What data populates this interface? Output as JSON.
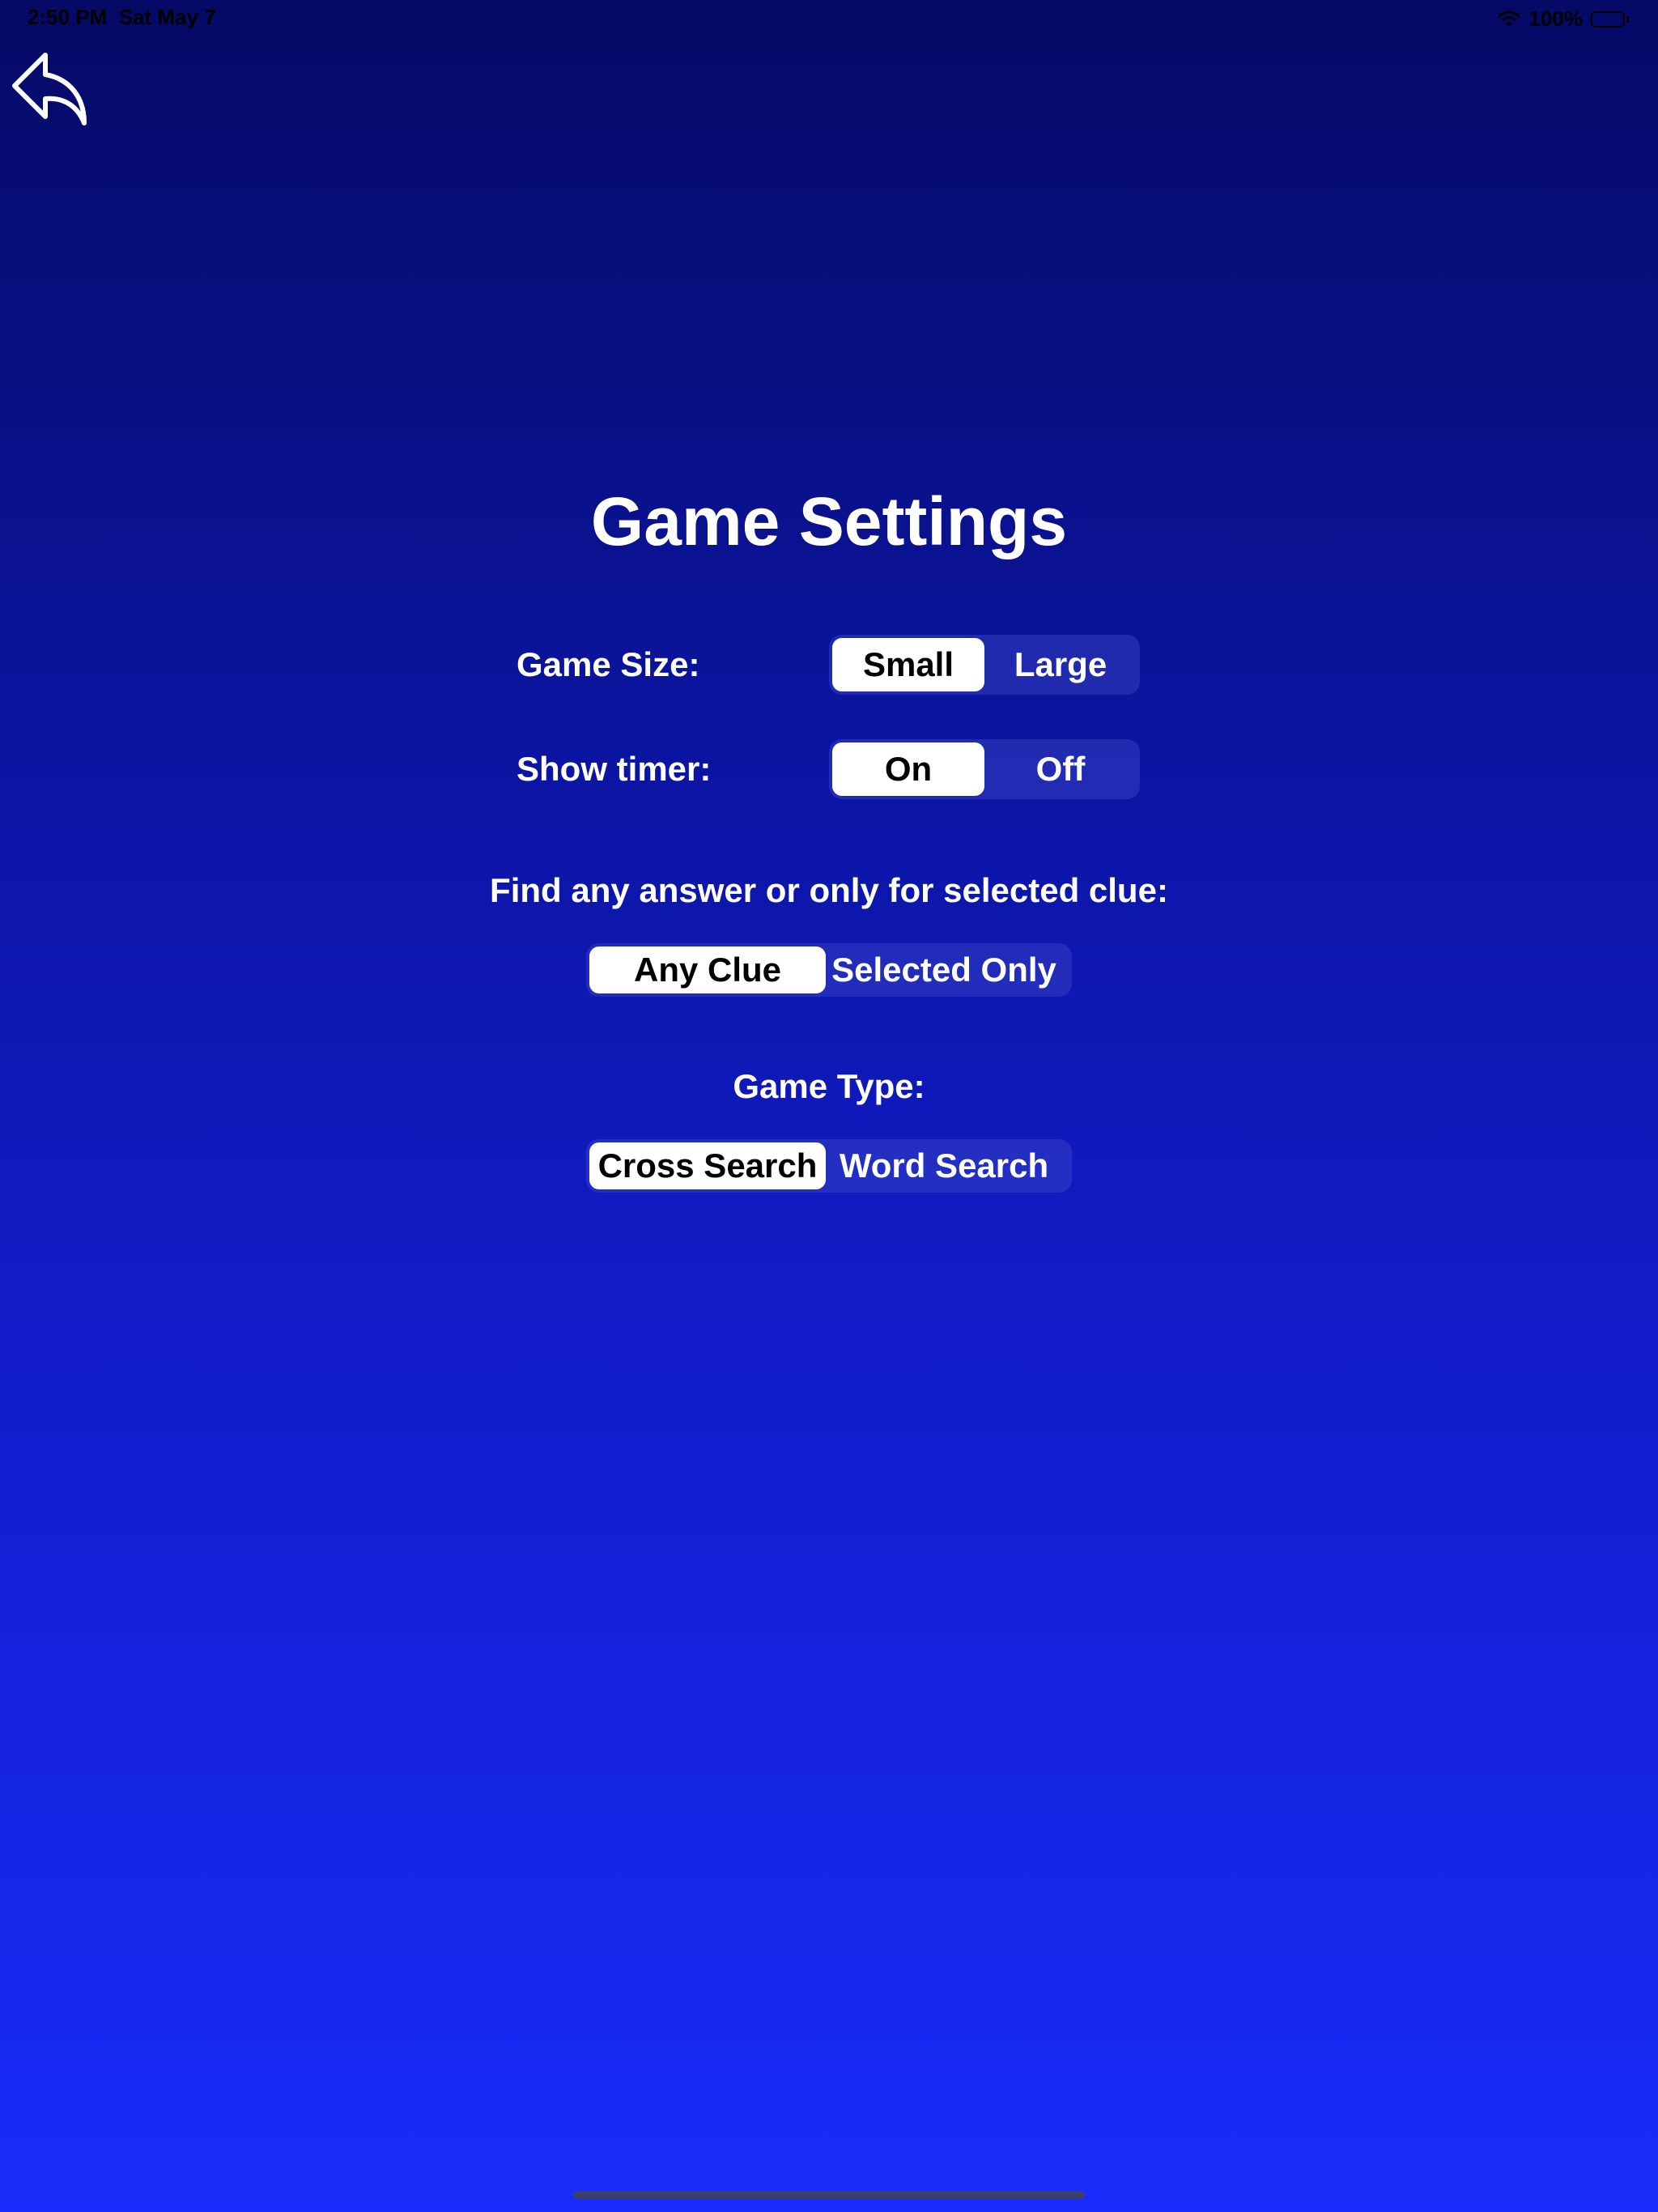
{
  "status_bar": {
    "time": "2:50 PM",
    "date": "Sat May 7",
    "battery": "100%"
  },
  "back_icon": "reply-arrow-icon",
  "title": "Game Settings",
  "settings": {
    "game_size": {
      "label": "Game Size:",
      "options": [
        "Small",
        "Large"
      ],
      "selected": "Small"
    },
    "show_timer": {
      "label": "Show timer:",
      "options": [
        "On",
        "Off"
      ],
      "selected": "On"
    },
    "find_mode": {
      "label": "Find any answer or only for selected clue:",
      "options": [
        "Any Clue",
        "Selected Only"
      ],
      "selected": "Any Clue"
    },
    "game_type": {
      "label": "Game Type:",
      "options": [
        "Cross Search",
        "Word Search"
      ],
      "selected": "Cross Search"
    }
  },
  "colors": {
    "background_top": "#050a66",
    "background_bottom": "#1a2cfb",
    "segment_selected_bg": "#ffffff",
    "segment_selected_text": "#000000",
    "text": "#ffffff"
  }
}
